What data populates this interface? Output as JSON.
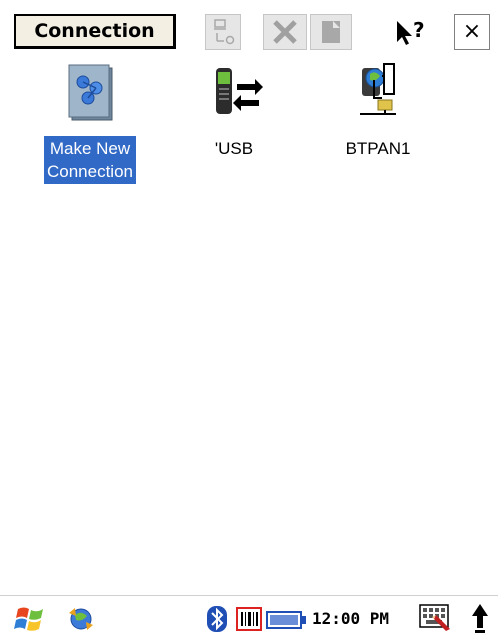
{
  "window": {
    "title": "Connection"
  },
  "toolbar": {
    "buttons": [
      {
        "name": "network-properties-icon",
        "enabled": false
      },
      {
        "name": "delete-icon",
        "enabled": false
      },
      {
        "name": "properties-icon",
        "enabled": false
      },
      {
        "name": "help-icon",
        "enabled": true
      },
      {
        "name": "close-icon",
        "enabled": true
      }
    ],
    "help_glyph": "?",
    "close_glyph": "×"
  },
  "items": [
    {
      "label_line1": "Make New",
      "label_line2": "Connection",
      "icon": "make-new-connection-icon",
      "selected": true
    },
    {
      "label": "'USB",
      "icon": "usb-connection-icon",
      "selected": false
    },
    {
      "label": "BTPAN1",
      "icon": "network-connection-icon",
      "selected": false
    }
  ],
  "taskbar": {
    "time": "12:00 PM",
    "icons": [
      "start-icon",
      "connectivity-icon",
      "bluetooth-icon",
      "barcode-icon",
      "battery-icon",
      "keyboard-icon",
      "up-arrow-icon"
    ]
  }
}
